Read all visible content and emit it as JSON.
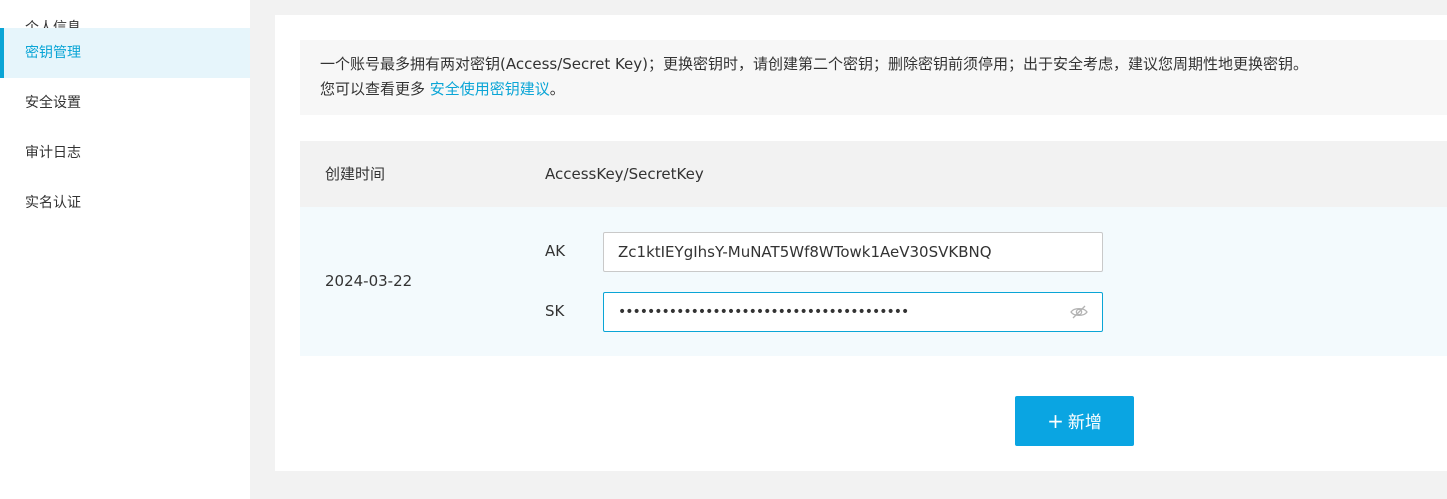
{
  "sidebar": {
    "items": [
      {
        "label": "个人信息"
      },
      {
        "label": "密钥管理"
      },
      {
        "label": "安全设置"
      },
      {
        "label": "审计日志"
      },
      {
        "label": "实名认证"
      }
    ]
  },
  "notice": {
    "line1": "一个账号最多拥有两对密钥(Access/Secret Key)；更换密钥时，请创建第二个密钥；删除密钥前须停用；出于安全考虑，建议您周期性地更换密钥。",
    "line2_prefix": "您可以查看更多 ",
    "link_text": "安全使用密钥建议",
    "line2_suffix": "。"
  },
  "table": {
    "headers": {
      "created": "创建时间",
      "keys": "AccessKey/SecretKey"
    },
    "rows": [
      {
        "date": "2024-03-22",
        "ak_label": "AK",
        "ak_value": "Zc1ktIEYgIhsY-MuNAT5Wf8WTowk1AeV30SVKBNQ",
        "sk_label": "SK",
        "sk_value": "••••••••••••••••••••••••••••••••••••••••"
      }
    ]
  },
  "actions": {
    "add_label": "新增",
    "add_icon": "plus-icon"
  },
  "colors": {
    "accent": "#0aa5d6",
    "button": "#0aa5e2",
    "active_bg": "#e6f5fb"
  }
}
